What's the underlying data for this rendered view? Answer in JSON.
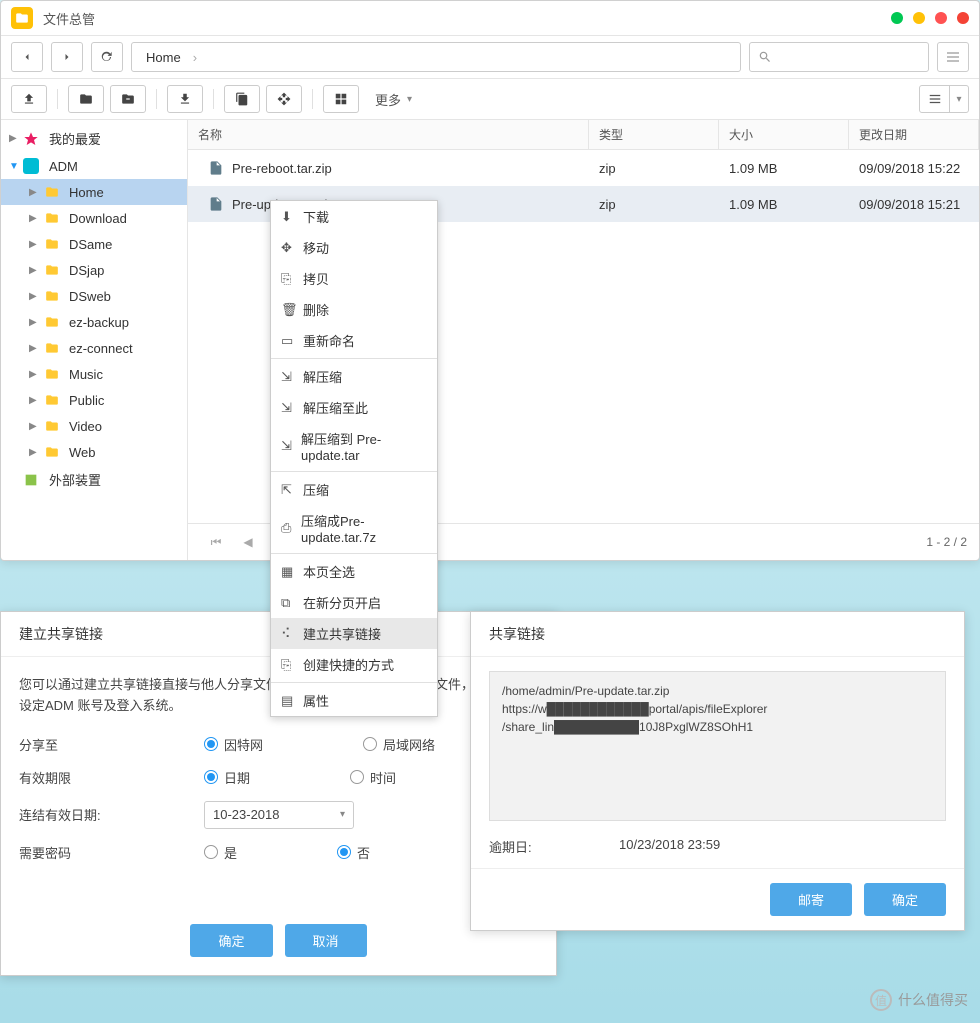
{
  "app_title": "文件总管",
  "breadcrumb": {
    "root": "Home"
  },
  "toolbar": {
    "more": "更多"
  },
  "sidebar": {
    "favorites": "我的最爱",
    "adm": "ADM",
    "folders": [
      "Home",
      "Download",
      "DSame",
      "DSjap",
      "DSweb",
      "ez-backup",
      "ez-connect",
      "Music",
      "Public",
      "Video",
      "Web"
    ],
    "external": "外部装置"
  },
  "columns": {
    "name": "名称",
    "type": "类型",
    "size": "大小",
    "date": "更改日期"
  },
  "files": [
    {
      "name": "Pre-reboot.tar.zip",
      "type": "zip",
      "size": "1.09 MB",
      "date": "09/09/2018 15:22"
    },
    {
      "name": "Pre-update.tar.zip",
      "type": "zip",
      "size": "1.09 MB",
      "date": "09/09/2018 15:21"
    }
  ],
  "pager": {
    "status": "1 - 2 / 2"
  },
  "context_menu": [
    "下载",
    "移动",
    "拷贝",
    "删除",
    "重新命名",
    "解压缩",
    "解压缩至此",
    "解压缩到 Pre-update.tar",
    "压缩",
    "压缩成Pre-update.tar.7z",
    "本页全选",
    "在新分页开启",
    "建立共享链接",
    "创建快捷的方式",
    "属性"
  ],
  "dialog1": {
    "title": "建立共享链接",
    "desc": "您可以通过建立共享链接直接与他人分享文件。只要输入连结即可直接存文件，不需另外设定ADM 账号及登入系统。",
    "share_to": "分享至",
    "internet": "因特网",
    "lan": "局域网络",
    "expire": "有效期限",
    "date_opt": "日期",
    "time_opt": "时间",
    "expire_date": "连结有效日期:",
    "date_value": "10-23-2018",
    "need_password": "需要密码",
    "yes": "是",
    "no": "否",
    "ok": "确定",
    "cancel": "取消"
  },
  "dialog2": {
    "title": "共享链接",
    "link_line1": "/home/admin/Pre-update.tar.zip",
    "link_line2": "https://w████████████portal/apis/fileExplorer",
    "link_line3": "/share_lin██████████10J8PxglWZ8SOhH1",
    "expire_label": "逾期日:",
    "expire_value": "10/23/2018 23:59",
    "mail": "邮寄",
    "ok": "确定"
  },
  "watermark": "什么值得买"
}
